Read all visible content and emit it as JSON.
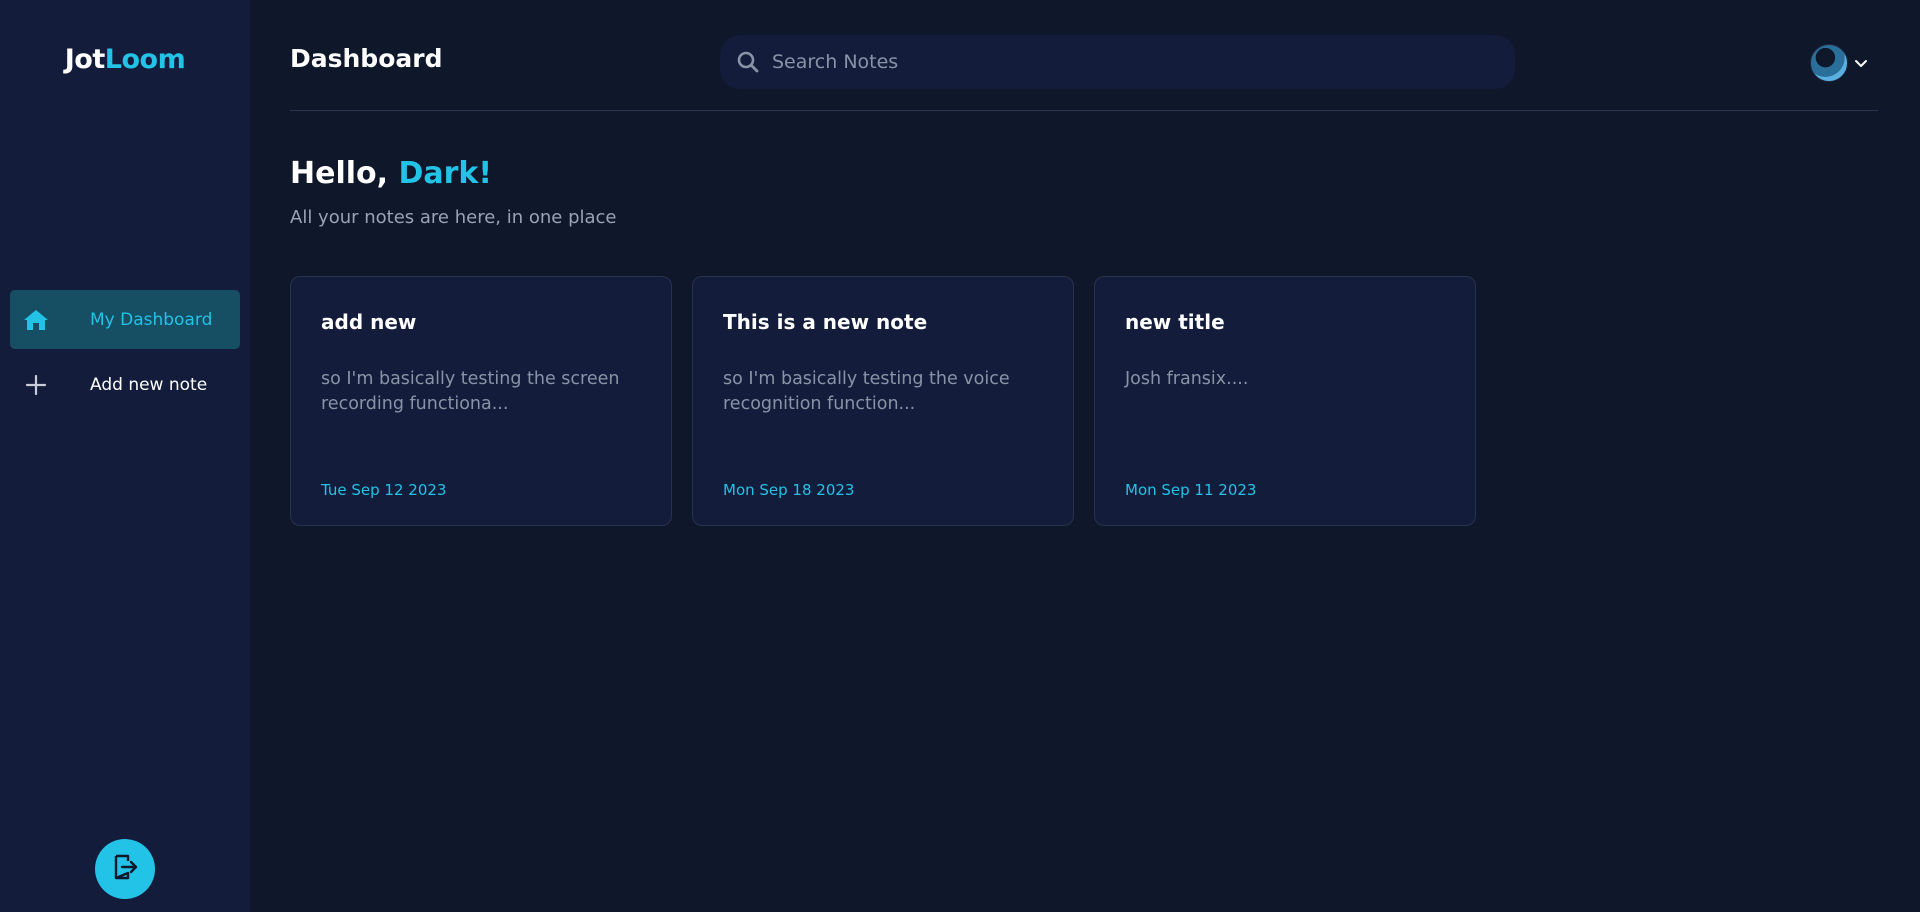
{
  "sidebar": {
    "logo_part1": "Jot",
    "logo_part2": "Loom",
    "items": [
      {
        "label": "My Dashboard",
        "icon": "home-icon",
        "active": true
      },
      {
        "label": "Add new note",
        "icon": "plus-icon",
        "active": false
      }
    ],
    "logout_icon": "logout-icon"
  },
  "header": {
    "title": "Dashboard",
    "search_placeholder": "Search Notes",
    "search_value": ""
  },
  "greeting": {
    "prefix": "Hello, ",
    "name": "Dark!",
    "subtitle": "All your notes are here, in one place"
  },
  "notes": [
    {
      "title": "add new",
      "excerpt": "so I'm basically testing the screen recording functiona...",
      "date": "Tue Sep 12 2023"
    },
    {
      "title": "This is a new note",
      "excerpt": "so I'm basically testing the voice recognition function...",
      "date": "Mon Sep 18 2023"
    },
    {
      "title": "new title",
      "excerpt": "Josh fransix....",
      "date": "Mon Sep 11 2023"
    }
  ],
  "colors": {
    "background": "#0f172a",
    "sidebar": "#131d3b",
    "accent": "#22c3e6",
    "active_nav": "#164e63"
  }
}
